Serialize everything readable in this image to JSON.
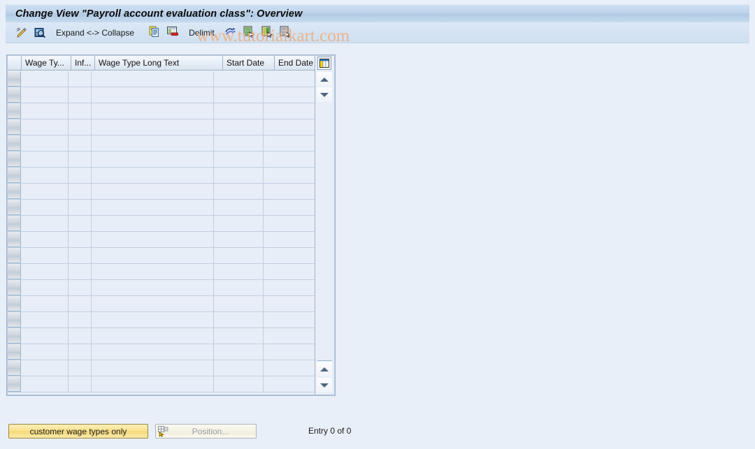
{
  "window": {
    "title": "Change View \"Payroll account evaluation class\": Overview"
  },
  "watermark": {
    "text": "www.tutorialkart.com",
    "color": "#edb183"
  },
  "toolbar": {
    "items": [
      {
        "name": "display-change-icon",
        "label": "",
        "icon": "pencil-icon"
      },
      {
        "name": "details-icon",
        "label": "",
        "icon": "magnifier-document-icon"
      },
      {
        "name": "expand-collapse",
        "label": "Expand <-> Collapse",
        "icon": ""
      },
      {
        "name": "copy-as-icon",
        "label": "",
        "icon": "copy-pages-icon"
      },
      {
        "name": "delete-row-icon",
        "label": "",
        "icon": "table-delete-icon"
      },
      {
        "name": "delimit-button",
        "label": "Delimit",
        "icon": ""
      },
      {
        "name": "undo-icon",
        "label": "",
        "icon": "undo-arrows-icon"
      },
      {
        "name": "select-all-icon",
        "label": "",
        "icon": "document-green-select-icon"
      },
      {
        "name": "select-block-icon",
        "label": "",
        "icon": "document-green-block-icon"
      },
      {
        "name": "deselect-all-icon",
        "label": "",
        "icon": "document-lines-deselect-icon"
      }
    ]
  },
  "table": {
    "settings_icon": "table-settings-icon",
    "columns": [
      {
        "key": "wage_type",
        "label": "Wage Ty..."
      },
      {
        "key": "infotype",
        "label": "Inf..."
      },
      {
        "key": "long_text",
        "label": "Wage Type Long Text"
      },
      {
        "key": "start_date",
        "label": "Start Date"
      },
      {
        "key": "end_date",
        "label": "End Date"
      }
    ],
    "rows": [],
    "empty_row_count": 20
  },
  "footer": {
    "customer_wage_types_label": "customer wage types only",
    "position_label": "Position...",
    "position_icon": "position-icon",
    "entry_count": "Entry 0 of 0"
  }
}
